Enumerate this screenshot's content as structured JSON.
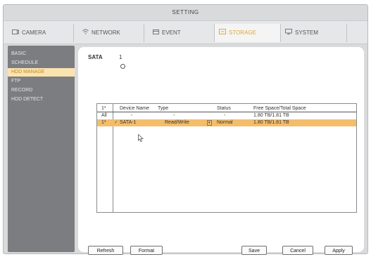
{
  "window": {
    "title": "SETTING"
  },
  "tabs": [
    {
      "label": "CAMERA",
      "icon": "camera-icon"
    },
    {
      "label": "NETWORK",
      "icon": "network-icon"
    },
    {
      "label": "EVENT",
      "icon": "event-icon"
    },
    {
      "label": "STORAGE",
      "icon": "storage-icon",
      "active": true
    },
    {
      "label": "SYSTEM",
      "icon": "system-icon"
    }
  ],
  "sidebar": {
    "items": [
      {
        "label": "BASIC"
      },
      {
        "label": "SCHEDULE"
      },
      {
        "label": "HDD MANAGE",
        "active": true
      },
      {
        "label": "FTP"
      },
      {
        "label": "RECORD"
      },
      {
        "label": "HDD DETECT"
      }
    ]
  },
  "sata": {
    "label": "SATA",
    "number": "1"
  },
  "table": {
    "columns": [
      "1*",
      "Device Name",
      "Type",
      "Status",
      "Free Space/Total Space"
    ],
    "rows": [
      {
        "id": "All",
        "device": "-",
        "type": "-",
        "status": "-",
        "space": "1.80 TB/1.81 TB"
      },
      {
        "id": "1*",
        "device": "SATA-1",
        "type": "Read/Write",
        "status": "Normal",
        "space": "1.80 TB/1.81 TB",
        "selected": true
      }
    ]
  },
  "buttons": {
    "refresh": "Refresh",
    "format": "Format",
    "save": "Save",
    "cancel": "Cancel",
    "apply": "Apply"
  },
  "colors": {
    "accent": "#e0a838",
    "selected_row": "#f4bd6a",
    "sidebar_bg": "#7b7d80",
    "sidebar_active": "#fbe3b0"
  }
}
